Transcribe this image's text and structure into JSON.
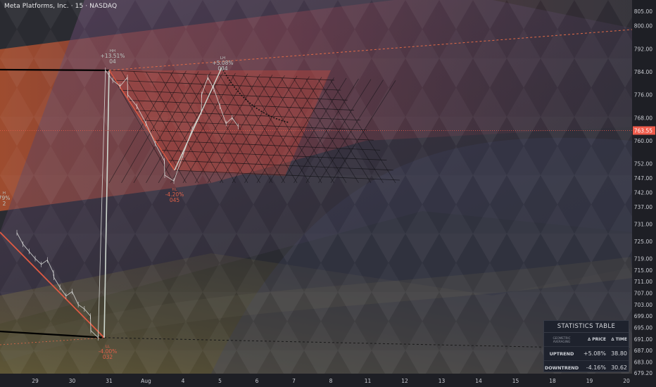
{
  "header": {
    "title": "Meta Platforms, Inc. · 15 · NASDAQ"
  },
  "chart_data": {
    "type": "line",
    "title": "Meta Platforms, Inc. · 15 · NASDAQ",
    "xlabel": "",
    "ylabel": "",
    "x_ticks": [
      "29",
      "30",
      "31",
      "Aug",
      "4",
      "5",
      "6",
      "7",
      "8",
      "11",
      "12",
      "13",
      "14",
      "15",
      "18",
      "19",
      "20"
    ],
    "y_ticks": [
      805.0,
      800.0,
      792.0,
      784.0,
      776.0,
      768.0,
      760.0,
      752.0,
      747.0,
      742.0,
      737.0,
      731.0,
      725.0,
      719.0,
      715.0,
      711.0,
      707.0,
      703.0,
      699.0,
      695.0,
      691.0,
      687.0,
      683.0,
      679.2
    ],
    "ylim": [
      678.0,
      807.0
    ],
    "current_price": "763.55",
    "series": [
      {
        "values": [
          [
            "29",
            728.0
          ],
          [
            "29",
            724.0
          ],
          [
            "29",
            721.5
          ],
          [
            "29",
            719.0
          ],
          [
            "29",
            717.0
          ],
          [
            "29",
            718.5
          ],
          [
            "29",
            714.0
          ],
          [
            "30",
            712.5
          ],
          [
            "30",
            709.0
          ],
          [
            "30",
            706.0
          ],
          [
            "30",
            707.5
          ],
          [
            "30",
            703.0
          ],
          [
            "30",
            701.5
          ],
          [
            "30",
            699.0
          ],
          [
            "31",
            694.0
          ],
          [
            "31",
            691.5
          ],
          [
            "31",
            784.5
          ],
          [
            "31",
            781.0
          ],
          [
            "31",
            779.0
          ],
          [
            "31",
            782.0
          ],
          [
            "Aug",
            776.0
          ],
          [
            "Aug",
            772.0
          ],
          [
            "Aug",
            766.0
          ],
          [
            "Aug",
            759.0
          ],
          [
            "Aug",
            753.0
          ],
          [
            "4",
            748.0
          ],
          [
            "4",
            746.0
          ],
          [
            "4",
            755.0
          ],
          [
            "4",
            764.0
          ],
          [
            "4",
            770.0
          ],
          [
            "5",
            776.0
          ],
          [
            "5",
            782.0
          ],
          [
            "5",
            778.0
          ],
          [
            "5",
            772.0
          ],
          [
            "5",
            766.0
          ],
          [
            "5",
            768.0
          ],
          [
            "5",
            765.0
          ]
        ]
      }
    ],
    "annotations": [
      {
        "label": "HH",
        "pct": "+13.51%",
        "bars": "04",
        "x": "31",
        "y": 784.5
      },
      {
        "label": "LH",
        "pct": "+5.08%",
        "bars": "034",
        "x": "5",
        "y": 782.0
      },
      {
        "label": "HL",
        "pct": "-4.20%",
        "bars": "045",
        "x": "4",
        "y": 746.0
      },
      {
        "label": "LL",
        "pct": "-4.00%",
        "bars": "032",
        "x": "31",
        "y": 691.5
      },
      {
        "label": "H",
        "pct": "79%",
        "bars": "2",
        "x": "29",
        "y": 735.0
      }
    ]
  },
  "stats_table": {
    "title": "STATISTICS TABLE",
    "header": {
      "label": "GEOMETRIC AVERAGING",
      "price": "PRICE",
      "time": "TIME",
      "price_icon": "delta-icon",
      "time_icon": "delta-icon"
    },
    "rows": [
      {
        "name": "UPTREND",
        "price": "+5.08%",
        "time": "38.80"
      },
      {
        "name": "DOWNTREND",
        "price": "-4.16%",
        "time": "30.62"
      }
    ]
  },
  "colors": {
    "background": "#2a2b31",
    "up": "#8fbf9a",
    "down": "#e06048",
    "price_tag": "#ef5b4b",
    "axis_text": "#c8cad0"
  }
}
